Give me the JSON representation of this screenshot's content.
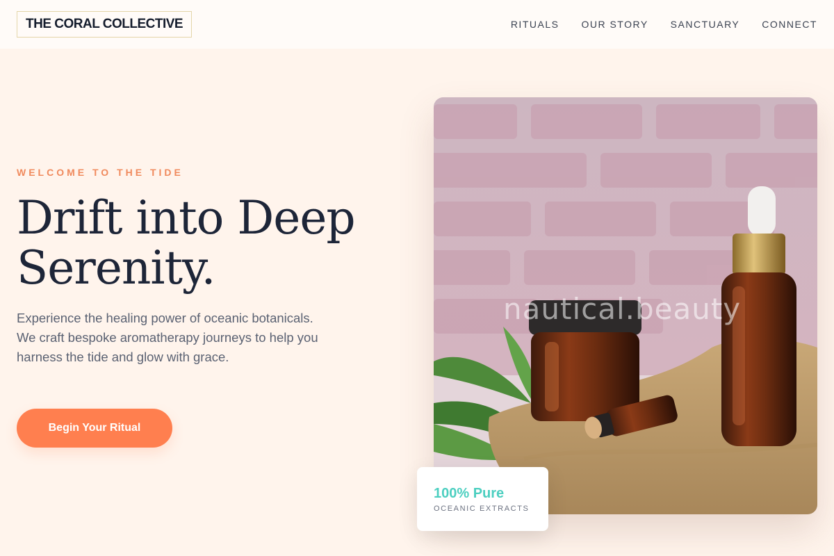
{
  "header": {
    "logo": "THE CORAL COLLECTIVE",
    "nav": [
      {
        "label": "RITUALS"
      },
      {
        "label": "OUR STORY"
      },
      {
        "label": "SANCTUARY"
      },
      {
        "label": "CONNECT"
      }
    ]
  },
  "hero": {
    "eyebrow": "WELCOME TO THE TIDE",
    "headline": "Drift into Deep Serenity.",
    "description": "Experience the healing power of oceanic botanicals. We craft bespoke aromatherapy journeys to help you harness the tide and glow with grace.",
    "cta_label": "Begin Your Ritual"
  },
  "image": {
    "watermark": "nautical.beauty"
  },
  "badge": {
    "title": "100% Pure",
    "subtitle": "OCEANIC EXTRACTS"
  },
  "colors": {
    "background": "#fff4ec",
    "accent": "#ff7f4f",
    "eyebrow": "#f08a5d",
    "teal": "#4ccfc0",
    "heading": "#1d2538"
  }
}
